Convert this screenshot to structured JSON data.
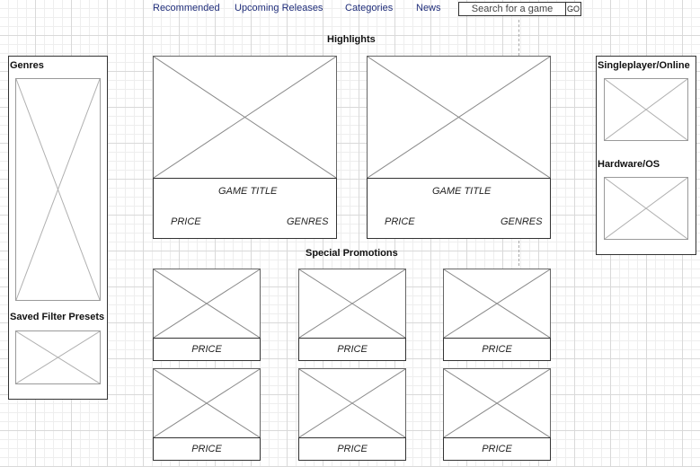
{
  "nav": {
    "recommended": "Recommended",
    "upcoming": "Upcoming Releases",
    "categories": "Categories",
    "news": "News",
    "search_placeholder": "Search for a game",
    "go_label": "GO"
  },
  "sidebar_left": {
    "genres_title": "Genres",
    "presets_title": "Saved Filter Presets"
  },
  "sidebar_right": {
    "singleplayer_title": "Singleplayer/Online",
    "hardware_title": "Hardware/OS"
  },
  "highlights": {
    "title": "Highlights",
    "cards": [
      {
        "title": "GAME TITLE",
        "price": "PRICE",
        "genres": "GENRES"
      },
      {
        "title": "GAME TITLE",
        "price": "PRICE",
        "genres": "GENRES"
      }
    ]
  },
  "promotions": {
    "title": "Special Promotions",
    "cards": [
      {
        "price": "PRICE"
      },
      {
        "price": "PRICE"
      },
      {
        "price": "PRICE"
      },
      {
        "price": "PRICE"
      },
      {
        "price": "PRICE"
      },
      {
        "price": "PRICE"
      }
    ]
  }
}
